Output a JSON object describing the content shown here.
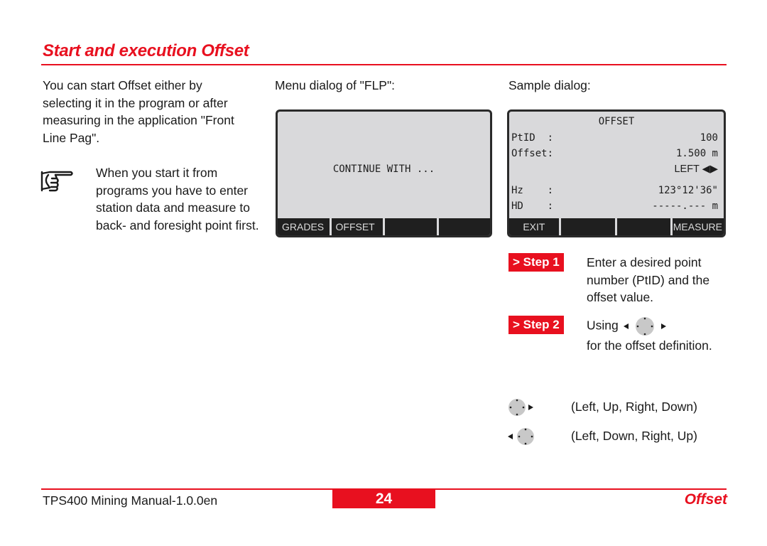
{
  "header": {
    "title": "Start and execution Offset",
    "accent_color": "#e8101f"
  },
  "intro": {
    "text": "You can start Offset either by selecting it in the program or after measuring in the application \"Front Line Pag\"."
  },
  "note": {
    "icon": "pointing-hand-icon",
    "text": "When you start it from programs you have to enter station data and measure to back- and foresight point first."
  },
  "menu_dialog": {
    "caption": "Menu dialog of \"FLP\":",
    "message": "CONTINUE WITH ...",
    "softkeys": [
      "GRADES",
      "OFFSET",
      "",
      ""
    ]
  },
  "sample_dialog": {
    "caption": "Sample dialog:",
    "title": "OFFSET",
    "rows": [
      {
        "label": "PtID  :",
        "value": "100"
      },
      {
        "label": "Offset:",
        "value": "1.500 m"
      },
      {
        "label": "",
        "value": "LEFT ◀▶"
      },
      {
        "label": "Hz    :",
        "value": "123°12'36\""
      },
      {
        "label": "HD    :",
        "value": "-----.--- m"
      }
    ],
    "softkeys": [
      "EXIT",
      "",
      "",
      "MEASURE"
    ]
  },
  "steps": [
    {
      "badge": "> Step 1",
      "text": "Enter a desired point number (PtID) and the offset value."
    },
    {
      "badge": "> Step 2",
      "text_before": "Using",
      "icon": "navigation-key-left-right-icon",
      "text_after": "for the offset definition."
    }
  ],
  "legend": [
    {
      "icon": "navigation-key-right-icon",
      "text": "(Left, Up, Right, Down)"
    },
    {
      "icon": "navigation-key-left-icon",
      "text": "(Left, Down, Right, Up)"
    }
  ],
  "footer": {
    "manual": "TPS400 Mining Manual-1.0.0en",
    "page": "24",
    "section": "Offset"
  }
}
